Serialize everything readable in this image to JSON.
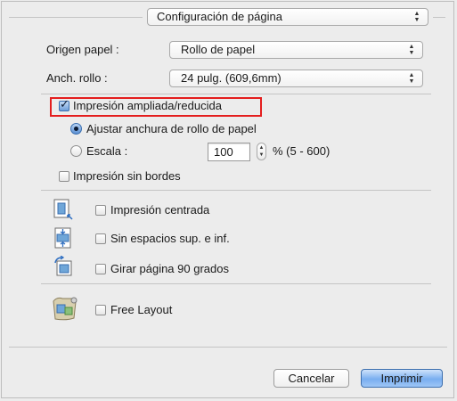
{
  "page_setup": {
    "value": "Configuración de página"
  },
  "paper_source": {
    "label": "Origen papel :",
    "value": "Rollo de papel"
  },
  "roll_width": {
    "label": "Anch. rollo :",
    "value": "24 pulg. (609,6mm)"
  },
  "enlarged_reduced": {
    "label": "Impresión ampliada/reducida",
    "checked": true
  },
  "fit_roll_width": {
    "label": "Ajustar anchura de rollo de papel",
    "selected": true
  },
  "scale": {
    "label": "Escala :",
    "value": "100",
    "range": "% (5 - 600)",
    "selected": false
  },
  "borderless": {
    "label": "Impresión sin bordes",
    "checked": false
  },
  "centered": {
    "label": "Impresión centrada",
    "checked": false,
    "icon": "centered-print-icon"
  },
  "no_spaces": {
    "label": "Sin espacios sup. e inf.",
    "checked": false,
    "icon": "no-spaces-icon"
  },
  "rotate": {
    "label": "Girar página 90 grados",
    "checked": false,
    "icon": "rotate-page-icon"
  },
  "free_layout": {
    "label": "Free Layout",
    "checked": false,
    "icon": "free-layout-icon"
  },
  "buttons": {
    "cancel": "Cancelar",
    "print": "Imprimir"
  },
  "colors": {
    "highlight": "#e41e1e",
    "primary_button": "#79aef0",
    "check_accent": "#3a6fb0"
  }
}
